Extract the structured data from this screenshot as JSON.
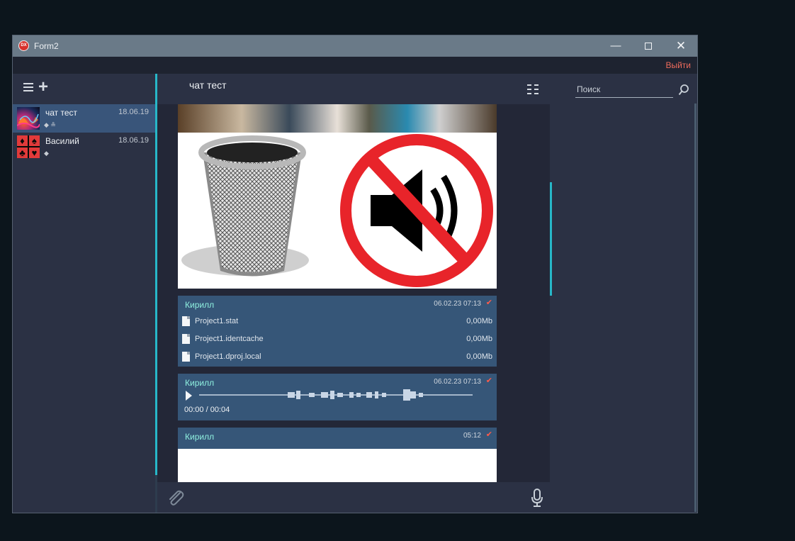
{
  "window": {
    "title": "Form2",
    "app_icon_text": "DX"
  },
  "header": {
    "logout_label": "Выйти"
  },
  "sidebar": {
    "chats": [
      {
        "name": "чат тест",
        "date": "18.06.19",
        "sub": "◆ ≗"
      },
      {
        "name": "Василий",
        "date": "18.06.19",
        "sub": "◆"
      }
    ]
  },
  "chat": {
    "title": "чат тест",
    "messages": [
      {
        "author": "Кирилл",
        "time": "06.02.23 07:13",
        "files": [
          {
            "name": "Project1.stat",
            "size": "0,00Mb"
          },
          {
            "name": "Project1.identcache",
            "size": "0,00Mb"
          },
          {
            "name": "Project1.dproj.local",
            "size": "0,00Mb"
          }
        ]
      },
      {
        "author": "Кирилл",
        "time": "06.02.23 07:13",
        "audio_time": "00:00 / 00:04"
      },
      {
        "author": "Кирилл",
        "time": "05:12"
      }
    ]
  },
  "search": {
    "placeholder": "Поиск"
  },
  "colors": {
    "accent": "#27b7c8",
    "author": "#8ff0df",
    "check": "#ff5b4a",
    "logout": "#ee6b5c",
    "active_chat": "#39557a"
  }
}
